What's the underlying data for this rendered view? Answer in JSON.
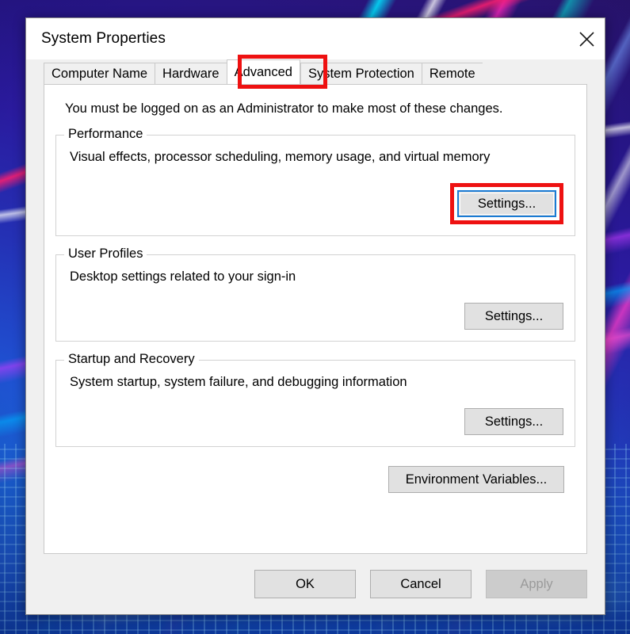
{
  "window": {
    "title": "System Properties",
    "close_icon": "close-icon"
  },
  "tabs": [
    {
      "label": "Computer Name",
      "selected": false
    },
    {
      "label": "Hardware",
      "selected": false
    },
    {
      "label": "Advanced",
      "selected": true
    },
    {
      "label": "System Protection",
      "selected": false
    },
    {
      "label": "Remote",
      "selected": false
    }
  ],
  "page": {
    "admin_note": "You must be logged on as an Administrator to make most of these changes.",
    "groups": [
      {
        "label": "Performance",
        "description": "Visual effects, processor scheduling, memory usage, and virtual memory",
        "button": "Settings..."
      },
      {
        "label": "User Profiles",
        "description": "Desktop settings related to your sign-in",
        "button": "Settings..."
      },
      {
        "label": "Startup and Recovery",
        "description": "System startup, system failure, and debugging information",
        "button": "Settings..."
      }
    ],
    "environment_variables_button": "Environment Variables..."
  },
  "footer": {
    "ok": "OK",
    "cancel": "Cancel",
    "apply": "Apply"
  },
  "colors": {
    "annotation_red": "#ee1111",
    "focus_blue": "#1a7bd4",
    "dialog_face": "#f0f0f0",
    "page_white": "#ffffff",
    "button_face": "#e1e1e1",
    "disabled_text": "#9a9a9a"
  }
}
